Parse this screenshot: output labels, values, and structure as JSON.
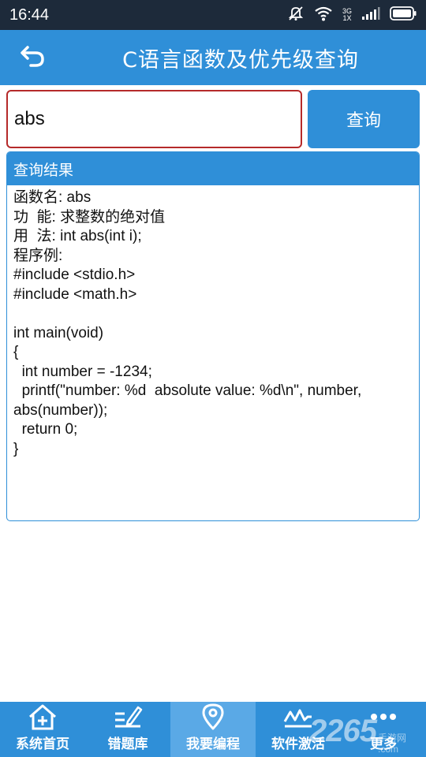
{
  "status_bar": {
    "time": "16:44",
    "network_top": "3G",
    "network_bottom": "1X",
    "icons": [
      "mute-icon",
      "wifi-icon",
      "signal-icon",
      "battery-icon"
    ]
  },
  "header": {
    "title": "C语言函数及优先级查询",
    "back_icon": "back-arrow-icon"
  },
  "search": {
    "value": "abs",
    "button_label": "查询"
  },
  "result": {
    "header": "查询结果",
    "content": "函数名: abs\n功  能: 求整数的绝对值\n用  法: int abs(int i);\n程序例:\n#include <stdio.h>\n#include <math.h>\n\nint main(void)\n{\n  int number = -1234;\n  printf(\"number: %d  absolute value: %d\\n\", number, abs(number));\n  return 0;\n}"
  },
  "bottom_nav": {
    "items": [
      {
        "label": "系统首页",
        "icon": "home-icon"
      },
      {
        "label": "错题库",
        "icon": "edit-list-icon"
      },
      {
        "label": "我要编程",
        "icon": "location-pin-icon",
        "active": true
      },
      {
        "label": "软件激活",
        "icon": "activity-icon"
      },
      {
        "label": "更多",
        "icon": "more-dots-icon"
      }
    ]
  },
  "watermark": {
    "number": "2265",
    "top_text": "手游网",
    "bottom_text": ".com"
  },
  "colors": {
    "primary": "#2f8fd8",
    "active_nav": "#5aa9e6",
    "status_bar": "#1d2a3a",
    "input_border": "#b52a2a"
  }
}
